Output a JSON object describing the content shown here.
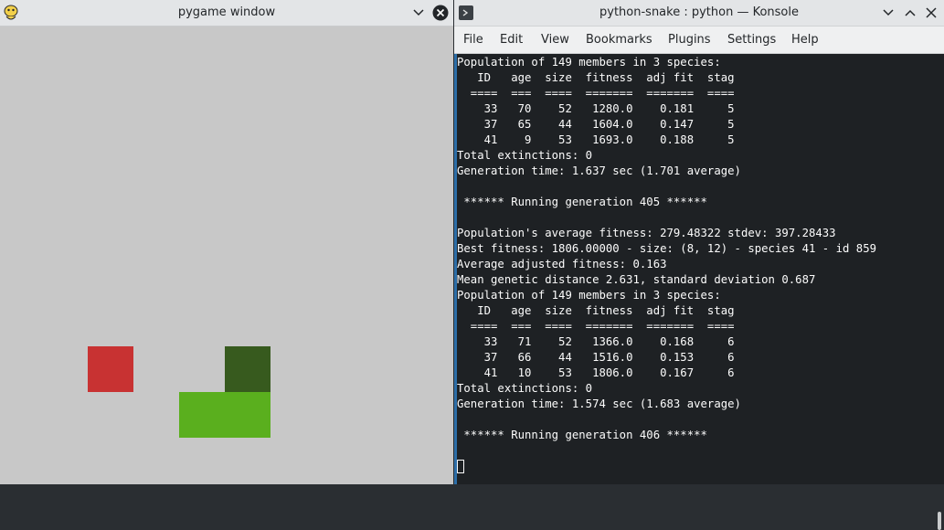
{
  "pygame": {
    "title": "pygame window",
    "icons": {
      "app": "snake-icon",
      "minimize": "chevron-down-icon",
      "close": "close-icon"
    },
    "colors": {
      "background": "#c8c8c8",
      "food": "#c83232",
      "snake_head": "#375a1e",
      "snake_body": "#5aaf1e"
    }
  },
  "konsole": {
    "title": "python-snake : python — Konsole",
    "icons": {
      "app": "terminal-icon",
      "minimize": "chevron-down-icon",
      "maximize": "chevron-up-icon",
      "close": "close-icon"
    },
    "menu": [
      "File",
      "Edit",
      "View",
      "Bookmarks",
      "Plugins",
      "Settings",
      "Help"
    ],
    "terminal_lines": [
      "Population of 149 members in 3 species:",
      "   ID   age  size  fitness  adj fit  stag",
      "  ====  ===  ====  =======  =======  ====",
      "    33   70    52   1280.0    0.181     5",
      "    37   65    44   1604.0    0.147     5",
      "    41    9    53   1693.0    0.188     5",
      "Total extinctions: 0",
      "Generation time: 1.637 sec (1.701 average)",
      "",
      " ****** Running generation 405 ******",
      "",
      "Population's average fitness: 279.48322 stdev: 397.28433",
      "Best fitness: 1806.00000 - size: (8, 12) - species 41 - id 859",
      "Average adjusted fitness: 0.163",
      "Mean genetic distance 2.631, standard deviation 0.687",
      "Population of 149 members in 3 species:",
      "   ID   age  size  fitness  adj fit  stag",
      "  ====  ===  ====  =======  =======  ====",
      "    33   71    52   1366.0    0.168     6",
      "    37   66    44   1516.0    0.153     6",
      "    41   10    53   1806.0    0.167     6",
      "Total extinctions: 0",
      "Generation time: 1.574 sec (1.683 average)",
      "",
      " ****** Running generation 406 ******",
      ""
    ]
  }
}
